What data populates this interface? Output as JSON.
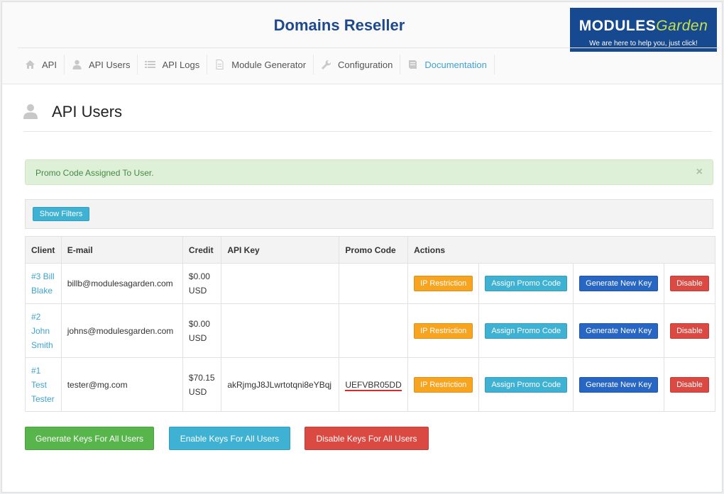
{
  "app": {
    "title": "Domains Reseller",
    "logo_main": "MODULES",
    "logo_garden": "Garden",
    "logo_tagline": "We are here to help you, just click!"
  },
  "nav": [
    {
      "label": "API",
      "icon": "home-icon"
    },
    {
      "label": "API Users",
      "icon": "user-icon"
    },
    {
      "label": "API Logs",
      "icon": "list-icon"
    },
    {
      "label": "Module Generator",
      "icon": "file-icon"
    },
    {
      "label": "Configuration",
      "icon": "wrench-icon"
    },
    {
      "label": "Documentation",
      "icon": "book-icon",
      "active": true
    }
  ],
  "page": {
    "title": "API Users"
  },
  "alert": {
    "message": "Promo Code Assigned To User.",
    "close": "×"
  },
  "filters": {
    "show_label": "Show Filters"
  },
  "table": {
    "headers": [
      "Client",
      "E-mail",
      "Credit",
      "API Key",
      "Promo Code",
      "Actions"
    ],
    "rows": [
      {
        "client": "#3 Bill Blake",
        "email": "billb@modulesagarden.com",
        "credit": "$0.00 USD",
        "api_key": "",
        "promo": ""
      },
      {
        "client": "#2 John Smith",
        "email": "johns@modulesgarden.com",
        "credit": "$0.00 USD",
        "api_key": "",
        "promo": ""
      },
      {
        "client": "#1 Test Tester",
        "email": "tester@mg.com",
        "credit": "$70.15 USD",
        "api_key": "akRjmgJ8JLwrtotqni8eYBqj",
        "promo": "UEFVBR05DD"
      }
    ],
    "actions": {
      "ip_restriction": "IP Restriction",
      "assign_promo": "Assign Promo Code",
      "generate_key": "Generate New Key",
      "disable": "Disable"
    }
  },
  "bulk": {
    "generate": "Generate Keys For All Users",
    "enable": "Enable Keys For All Users",
    "disable": "Disable Keys For All Users"
  },
  "colors": {
    "title": "#1e4a8c",
    "link": "#41a3cf",
    "alert_bg": "#dff0d8",
    "warning": "#f7a421",
    "info": "#3fb2d4",
    "primary": "#2766c3",
    "danger": "#db4a42",
    "success": "#57b54b"
  }
}
